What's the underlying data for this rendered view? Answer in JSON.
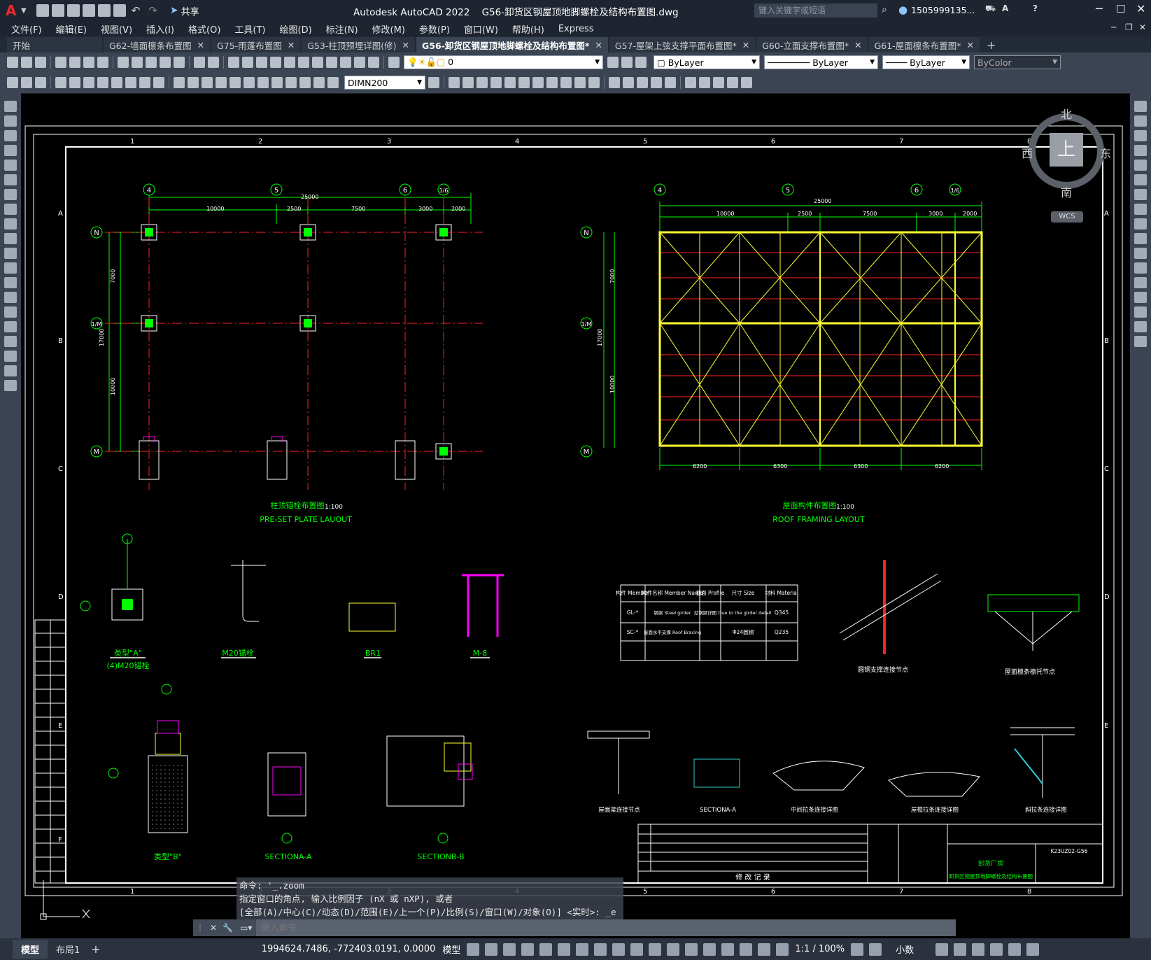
{
  "app": {
    "logo": "A",
    "title": "Autodesk AutoCAD 2022",
    "file": "G56-卸货区钢屋顶地脚螺栓及结构布置图.dwg",
    "share_label": "共享",
    "search_placeholder": "键入关键字或短语",
    "user": "1505999135...",
    "window_controls": [
      "minimize-icon",
      "maximize-icon",
      "close-icon"
    ]
  },
  "menu": [
    "文件(F)",
    "编辑(E)",
    "视图(V)",
    "插入(I)",
    "格式(O)",
    "工具(T)",
    "绘图(D)",
    "标注(N)",
    "修改(M)",
    "参数(P)",
    "窗口(W)",
    "帮助(H)",
    "Express"
  ],
  "tabs": [
    {
      "label": "开始",
      "active": false,
      "closable": false
    },
    {
      "label": "G62-墙面檩条布置图",
      "active": false,
      "closable": true
    },
    {
      "label": "G75-雨蓬布置图",
      "active": false,
      "closable": true
    },
    {
      "label": "G53-柱顶预埋详图(修)",
      "active": false,
      "closable": true
    },
    {
      "label": "G56-卸货区钢屋顶地脚螺栓及结构布置图*",
      "active": true,
      "closable": true
    },
    {
      "label": "G57-屋架上弦支撑平面布置图*",
      "active": false,
      "closable": true
    },
    {
      "label": "G60-立面支撑布置图*",
      "active": false,
      "closable": true
    },
    {
      "label": "G61-屋面檩条布置图*",
      "active": false,
      "closable": true
    }
  ],
  "toolbar": {
    "layer_value": "0",
    "color_value": "ByLayer",
    "linetype_value": "ByLayer",
    "lineweight_value": "ByLayer",
    "plotstyle_value": "ByColor",
    "dimstyle_value": "DIMN200"
  },
  "viewcube": {
    "north": "北",
    "south": "南",
    "east": "东",
    "west": "西",
    "top": "上",
    "wcs": "WCS"
  },
  "drawing": {
    "col_numbers": [
      "1",
      "2",
      "3",
      "4",
      "5",
      "6",
      "7",
      "8"
    ],
    "row_letters": [
      "A",
      "B",
      "C",
      "D",
      "E",
      "F"
    ],
    "plate_grid_labels": [
      "4",
      "5",
      "6",
      "1/6"
    ],
    "row_axes": [
      "N",
      "1/M",
      "M"
    ],
    "plan_total": "25000",
    "plan_dims": [
      "10000",
      "2500",
      "7500",
      "3000",
      "2000"
    ],
    "vert_dims": [
      "7000",
      "10000",
      "17000"
    ],
    "framing_bottom_dims": [
      "6200",
      "6300",
      "6300",
      "6200"
    ],
    "left_title_cn": "柱顶锚栓布置图",
    "left_title_scale": "1:100",
    "left_title_en": "PRE-SET PLATE LAUOUT",
    "right_title_cn": "屋面构件布置图",
    "right_title_scale": "1:100",
    "right_title_en": "ROOF FRAMING LAYOUT",
    "details": [
      "类型\"A\"",
      "(4)M20锚栓",
      "M20锚栓",
      "BR1",
      "M-8",
      "类型\"B\"",
      "SECTIONA-A",
      "SECTIONB-B"
    ],
    "table": {
      "headers": [
        "构件\nMember",
        "构件名称\nMember Name",
        "截面\nProfile",
        "尺寸\nSize",
        "材料\nMaterial"
      ],
      "rows": [
        [
          "GL-*",
          "钢梁 Steel girder",
          "见钢梁详图 Due to the girder detail",
          "",
          "Q345"
        ],
        [
          "SC-*",
          "屋面水平支撑 Roof Bracing",
          "",
          "Φ24圆钢",
          "Q235"
        ]
      ]
    },
    "right_details": [
      "圆钢支撑连接节点",
      "屋面檩条檩托节点",
      "屋面梁连接节点",
      "SECTIONA-A",
      "中间拉条连接详图",
      "屋檐拉条连接详图",
      "斜拉条连接详图"
    ],
    "revision_title": "修   改   记   录",
    "drawing_no": "K23UZ02-G56",
    "company_short": "卸货厂房",
    "sheet_name": "卸货区钢屋顶地脚螺栓及结构布置图"
  },
  "command": {
    "history_1": "命令: '_.zoom",
    "history_2": "指定窗口的角点, 输入比例因子 (nX 或 nXP), 或者",
    "history_3": "[全部(A)/中心(C)/动态(D)/范围(E)/上一个(P)/比例(S)/窗口(W)/对象(O)] <实时>: _e",
    "placeholder": "键入命令"
  },
  "status": {
    "model_tab": "模型",
    "layout_tab": "布局1",
    "coords": "1994624.7486, -772403.0191, 0.0000",
    "space": "模型",
    "scale": "1:1 / 100%",
    "units": "小数"
  }
}
